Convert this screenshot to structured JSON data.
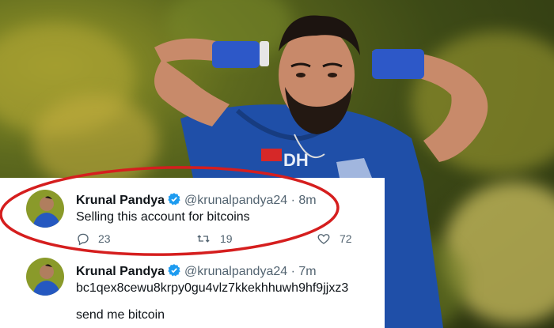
{
  "tweets": [
    {
      "name": "Krunal Pandya",
      "handle": "@krunalpandya24",
      "separator": "·",
      "time": "8m",
      "text": "Selling this account for bitcoins",
      "replies": "23",
      "retweets": "19",
      "likes": "72"
    },
    {
      "name": "Krunal Pandya",
      "handle": "@krunalpandya24",
      "separator": "·",
      "time": "7m",
      "text": "bc1qex8cewu8krpy0gu4vlz7kkekhhuwh9hf9jjxz3",
      "text2": "send me bitcoin"
    }
  ],
  "colors": {
    "highlight_ring": "#d51e1e",
    "verified_badge": "#1d9bf0",
    "jersey": "#1f4fa8",
    "background": "#5e6a1e"
  },
  "icons": [
    "reply-icon",
    "retweet-icon",
    "like-icon",
    "verified-badge-icon"
  ]
}
